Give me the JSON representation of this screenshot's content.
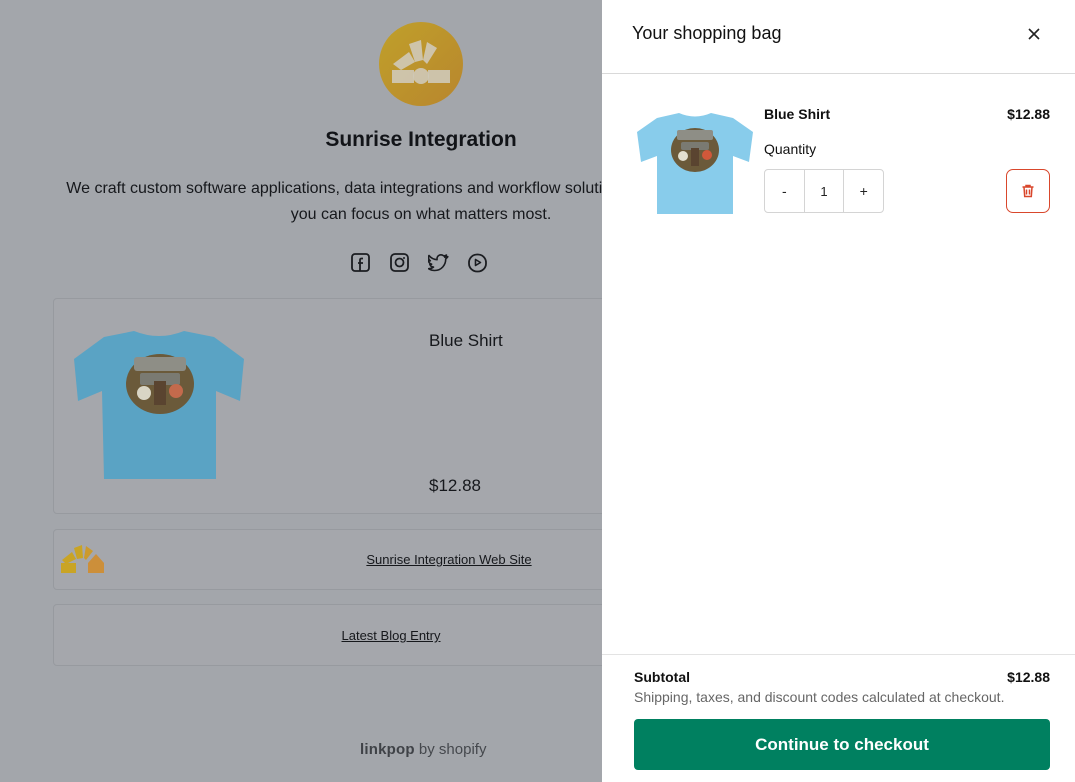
{
  "page": {
    "brand_name": "Sunrise Integration",
    "bio": "We craft custom software applications, data integrations and workflow solutions for your business so you can focus on what matters most.",
    "socials": [
      "facebook-icon",
      "instagram-icon",
      "twitter-icon",
      "youtube-icon"
    ],
    "product": {
      "name": "Blue Shirt",
      "price": "$12.88"
    },
    "links": [
      {
        "label": "Sunrise Integration Web Site"
      },
      {
        "label": "Latest Blog Entry"
      }
    ],
    "footer": {
      "brand": "linkpop",
      "suffix": "by shopify"
    }
  },
  "cart": {
    "title": "Your shopping bag",
    "item": {
      "name": "Blue Shirt",
      "price": "$12.88",
      "quantity_label": "Quantity",
      "quantity": "1",
      "decrement": "-",
      "increment": "+"
    },
    "subtotal_label": "Subtotal",
    "subtotal_value": "$12.88",
    "note": "Shipping, taxes, and discount codes calculated at checkout.",
    "checkout_label": "Continue to checkout",
    "colors": {
      "checkout": "#008060",
      "delete": "#d9472c"
    }
  }
}
